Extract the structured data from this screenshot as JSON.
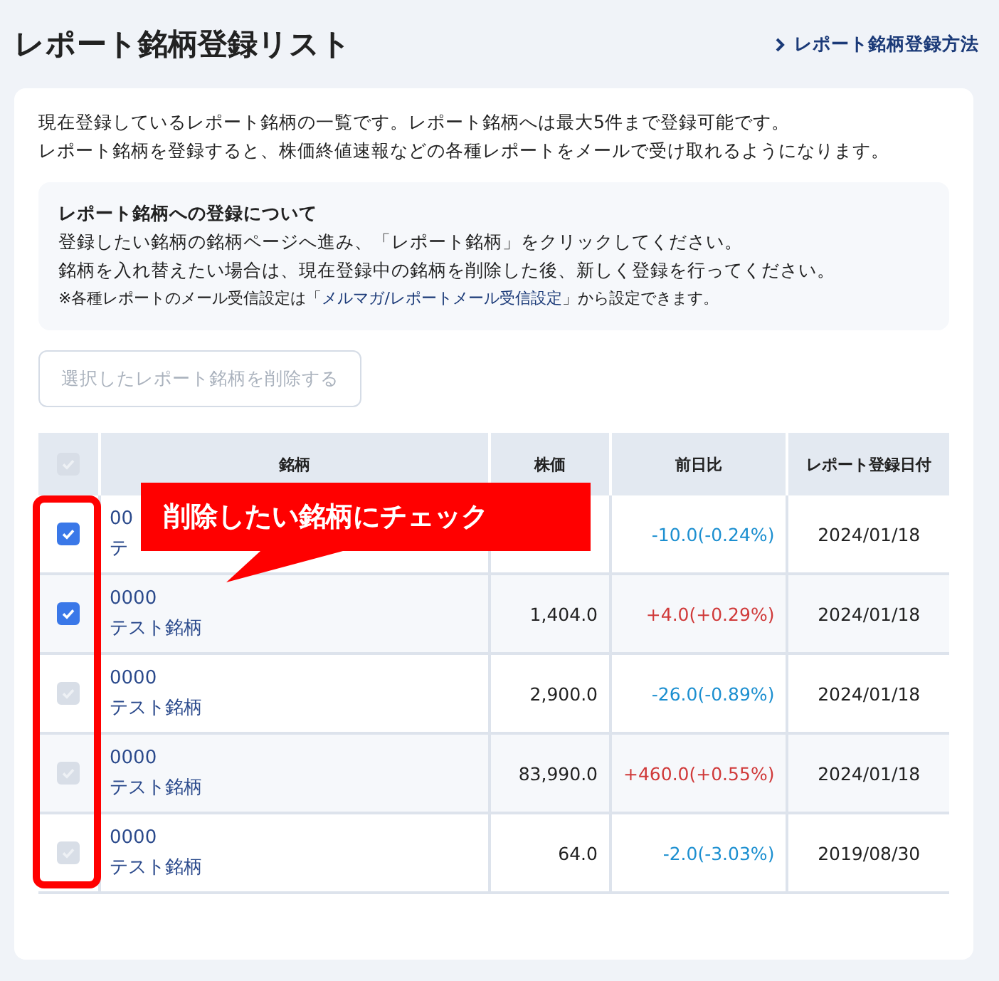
{
  "page_title": "レポート銘柄登録リスト",
  "help_link": "レポート銘柄登録方法",
  "intro": [
    "現在登録しているレポート銘柄の一覧です。レポート銘柄へは最大5件まで登録可能です。",
    "レポート銘柄を登録すると、株価終値速報などの各種レポートをメールで受け取れるようになります。"
  ],
  "notice": {
    "title": "レポート銘柄への登録について",
    "lines": [
      "登録したい銘柄の銘柄ページへ進み、「レポート銘柄」をクリックしてください。",
      "銘柄を入れ替えたい場合は、現在登録中の銘柄を削除した後、新しく登録を行ってください。"
    ],
    "note_before": "※各種レポートのメール受信設定は「",
    "note_link": "メルマガ/レポートメール受信設定",
    "note_after": "」から設定できます。"
  },
  "delete_button": {
    "label": "選択したレポート銘柄を削除する",
    "disabled": true
  },
  "table": {
    "header_checkbox": {
      "checked": false,
      "disabled": true
    },
    "columns": [
      "銘柄",
      "株価",
      "前日比",
      "レポート登録日付"
    ],
    "rows": [
      {
        "code": "00",
        "name": "テ",
        "change": "-10.0(-0.24%)",
        "color": "#1c8fd0",
        "date": "2024/01/18",
        "checked": true,
        "disabled": false
      },
      {
        "code": "0000",
        "name": "テスト銘柄",
        "price": "1,404.0",
        "change": "+4.0(+0.29%)",
        "color": "#d03a3a",
        "date": "2024/01/18",
        "checked": true,
        "disabled": false
      },
      {
        "code": "0000",
        "name": "テスト銘柄",
        "price": "2,900.0",
        "change": "-26.0(-0.89%)",
        "color": "#1c8fd0",
        "date": "2024/01/18",
        "checked": false,
        "disabled": true
      },
      {
        "code": "0000",
        "name": "テスト銘柄",
        "price": "83,990.0",
        "change": "+460.0(+0.55%)",
        "color": "#d03a3a",
        "date": "2024/01/18",
        "checked": false,
        "disabled": true
      },
      {
        "code": "0000",
        "name": "テスト銘柄",
        "price": "64.0",
        "change": "-2.0(-3.03%)",
        "color": "#1c8fd0",
        "date": "2019/08/30",
        "checked": false,
        "disabled": true
      }
    ]
  },
  "callout": "削除したい銘柄にチェック"
}
